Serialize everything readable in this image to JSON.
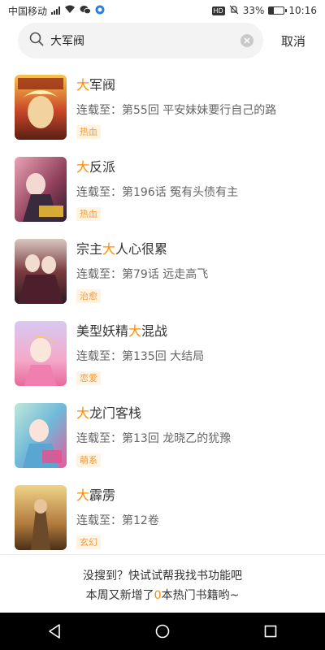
{
  "status_bar": {
    "carrier": "中国移动",
    "battery": "33%",
    "battery_level": 0.33,
    "time": "10:16",
    "hd_badge": "HD"
  },
  "search": {
    "query": "大军阀",
    "cancel_label": "取消"
  },
  "results": [
    {
      "title_pre": "",
      "title_hl": "大",
      "title_post": "军阀",
      "update": "连载至：第55回 平安妹妹要行自己的路",
      "tag": "热血"
    },
    {
      "title_pre": "",
      "title_hl": "大",
      "title_post": "反派",
      "update": "连载至：第196话 冤有头债有主",
      "tag": "热血"
    },
    {
      "title_pre": "宗主",
      "title_hl": "大",
      "title_post": "人心很累",
      "update": "连载至：第79话 远走高飞",
      "tag": "治愈"
    },
    {
      "title_pre": "美型妖精",
      "title_hl": "大",
      "title_post": "混战",
      "update": "连载至：第135回 大结局",
      "tag": "恋爱"
    },
    {
      "title_pre": "",
      "title_hl": "大",
      "title_post": "龙门客栈",
      "update": "连载至：第13回 龙晓乙的犹豫",
      "tag": "萌系"
    },
    {
      "title_pre": "",
      "title_hl": "大",
      "title_post": "霹雳",
      "update": "连载至：第12卷",
      "tag": "玄幻"
    }
  ],
  "footer_tip": {
    "line1": "没搜到？快试试帮我找书功能吧",
    "line2_pre": "本周又新增了",
    "line2_num": "0",
    "line2_post": "本热门书籍哟~"
  },
  "colors": {
    "highlight": "#ff8c00",
    "tag_text": "#f39a3a",
    "tag_bg": "#fff3e2"
  }
}
